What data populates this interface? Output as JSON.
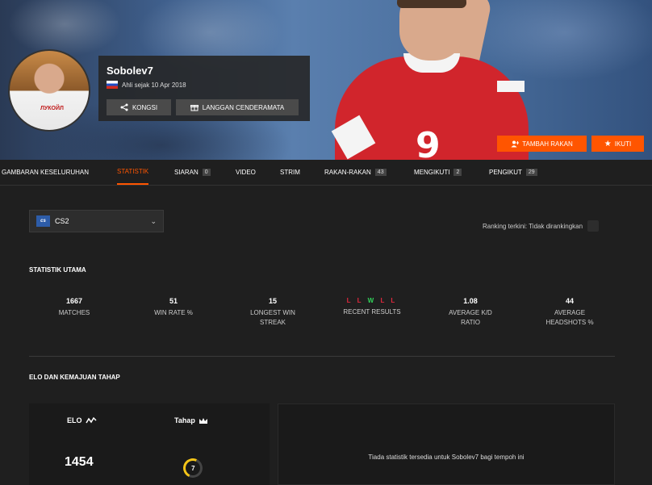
{
  "profile": {
    "username": "Sobolev7",
    "member_since": "Ahli sejak 10 Apr 2018",
    "share_label": "KONGSI",
    "gift_label": "LANGGAN CENDERAMATA",
    "avatar_shirt_text": "ЛУКОЙЛ",
    "banner_shirt_number": "9"
  },
  "actions": {
    "add_friend": "TAMBAH RAKAN",
    "follow": "IKUTI"
  },
  "tabs": [
    {
      "label": "GAMBARAN KESELURUHAN"
    },
    {
      "label": "STATISTIK"
    },
    {
      "label": "SIARAN",
      "count": "0"
    },
    {
      "label": "VIDEO"
    },
    {
      "label": "STRIM"
    },
    {
      "label": "RAKAN-RAKAN",
      "count": "43"
    },
    {
      "label": "MENGIKUTI",
      "count": "2"
    },
    {
      "label": "PENGIKUT",
      "count": "29"
    }
  ],
  "game": {
    "logo": "cs",
    "name": "CS2"
  },
  "ranking": "Ranking terkini: Tidak dirankingkan",
  "main_stats": {
    "title": "STATISTIK UTAMA",
    "matches": {
      "value": "1667",
      "label": "MATCHES"
    },
    "win_rate": {
      "value": "51",
      "label": "WIN RATE %"
    },
    "longest_streak": {
      "value": "15",
      "label_1": "LONGEST WIN",
      "label_2": "STREAK"
    },
    "recent_results": {
      "results": [
        "L",
        "L",
        "W",
        "L",
        "L"
      ],
      "label": "RECENT RESULTS"
    },
    "avg_kd": {
      "value": "1.08",
      "label_1": "AVERAGE K/D",
      "label_2": "RATIO"
    },
    "avg_hs": {
      "value": "44",
      "label_1": "AVERAGE",
      "label_2": "HEADSHOTS %"
    }
  },
  "elo_section": {
    "title": "ELO DAN KEMAJUAN TAHAP",
    "elo_label": "ELO",
    "elo_value": "1454",
    "level_label": "Tahap",
    "level_value": "7",
    "empty_message": "Tiada statistik tersedia untuk Sobolev7 bagi tempoh ini"
  },
  "colors": {
    "accent": "#ff5500",
    "loss": "#e0283e",
    "win": "#32d35a",
    "level": "#f5c518"
  }
}
